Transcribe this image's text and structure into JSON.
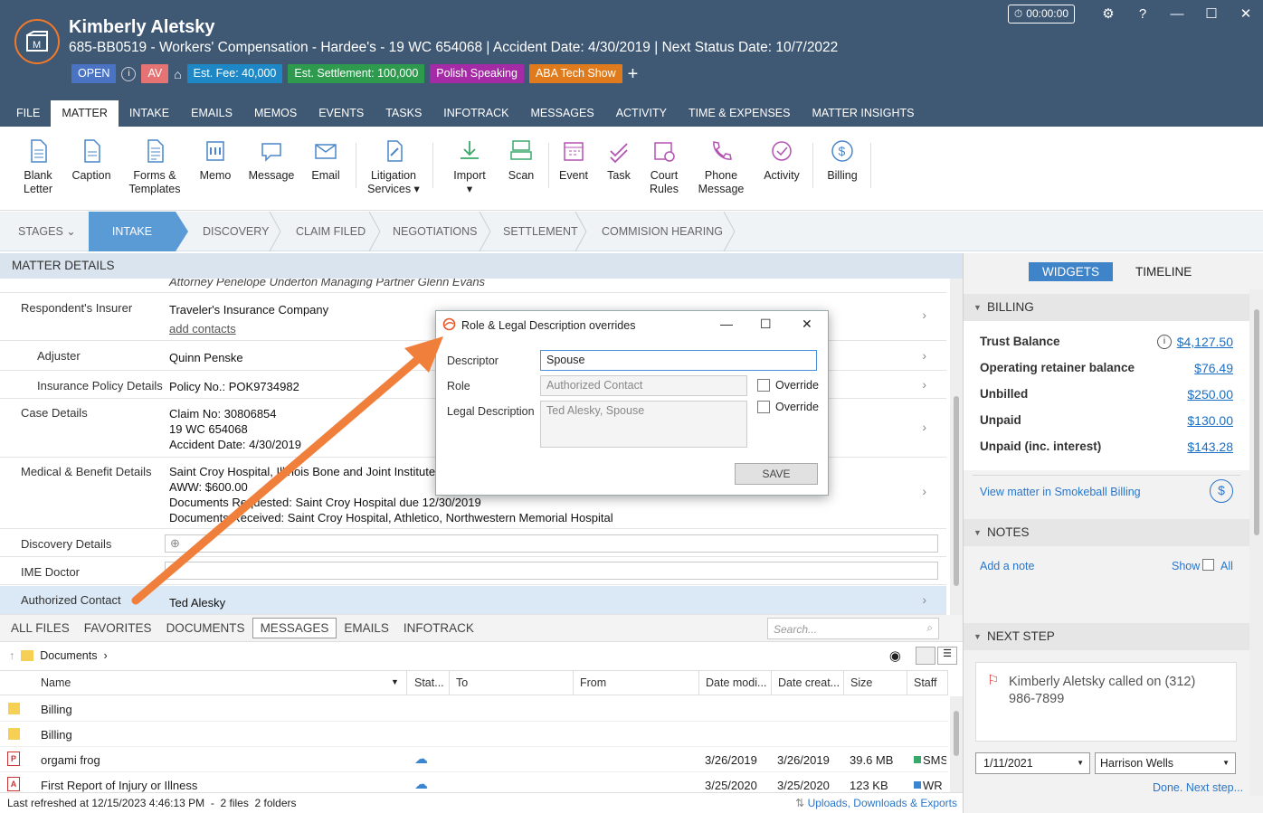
{
  "header": {
    "matter_name": "Kimberly Aletsky",
    "matter_subtitle": "685-BB0519 - Workers' Compensation - Hardee's - 19 WC 654068 | Accident Date: 4/30/2019 | Next Status Date: 10/7/2022",
    "timer": "00:00:00",
    "tags": [
      {
        "label": "OPEN",
        "color": "#4a73c4"
      },
      {
        "label": "AV",
        "color": "#e57373"
      },
      {
        "label": "Est. Fee: 40,000",
        "color": "#1e88c7"
      },
      {
        "label": "Est. Settlement: 100,000",
        "color": "#2e9a4e"
      },
      {
        "label": "Polish Speaking",
        "color": "#a52aa5"
      },
      {
        "label": "ABA Tech Show",
        "color": "#e07b1d"
      }
    ]
  },
  "tabs": [
    "FILE",
    "MATTER",
    "INTAKE",
    "EMAILS",
    "MEMOS",
    "EVENTS",
    "TASKS",
    "INFOTRACK",
    "MESSAGES",
    "ACTIVITY",
    "TIME & EXPENSES",
    "MATTER INSIGHTS"
  ],
  "ribbon": {
    "blank_letter": "Blank\nLetter",
    "caption": "Caption",
    "forms": "Forms &\nTemplates",
    "memo": "Memo",
    "message": "Message",
    "email": "Email",
    "litigation": "Litigation\nServices ▾",
    "import": "Import\n▾",
    "scan": "Scan",
    "event": "Event",
    "task": "Task",
    "court_rules": "Court\nRules",
    "phone_message": "Phone\nMessage",
    "activity": "Activity",
    "billing": "Billing"
  },
  "stages": {
    "label": "STAGES",
    "items": [
      "INTAKE",
      "DISCOVERY",
      "CLAIM FILED",
      "NEGOTIATIONS",
      "SETTLEMENT",
      "COMMISION HEARING"
    ]
  },
  "details": {
    "title": "MATTER DETAILS",
    "top_line": "Attorney Penelope Underton  Managing Partner Glenn Evans",
    "respondent_insurer": {
      "label": "Respondent's Insurer",
      "value": "Traveler's Insurance Company",
      "link": "add contacts"
    },
    "adjuster": {
      "label": "Adjuster",
      "value": "Quinn Penske"
    },
    "policy": {
      "label": "Insurance Policy Details",
      "value": "Policy No.: POK9734982"
    },
    "case": {
      "label": "Case Details",
      "lines": [
        "Claim No: 30806854",
        "19 WC 654068",
        "Accident Date: 4/30/2019"
      ]
    },
    "medical": {
      "label": "Medical & Benefit Details",
      "lines": [
        "Saint Croy Hospital, Illinois Bone and Joint Institute,",
        "AWW: $600.00",
        "Documents Requested: Saint Croy Hospital due 12/30/2019",
        "Documents Received: Saint Croy Hospital, Athletico, Northwestern Memorial Hospital"
      ]
    },
    "discovery": {
      "label": "Discovery Details"
    },
    "ime": {
      "label": "IME Doctor"
    },
    "authorized": {
      "label": "Authorized Contact",
      "value": "Ted Alesky"
    }
  },
  "files": {
    "tabs": [
      "ALL FILES",
      "FAVORITES",
      "DOCUMENTS",
      "MESSAGES",
      "EMAILS",
      "INFOTRACK"
    ],
    "search_placeholder": "Search...",
    "crumb": "Documents",
    "columns": [
      "Name",
      "Stat...",
      "To",
      "From",
      "Date modi...",
      "Date creat...",
      "Size",
      "Staff"
    ],
    "rows": [
      {
        "name": "Billing",
        "modified": "",
        "created": "",
        "size": "",
        "staff": ""
      },
      {
        "name": "Billing",
        "modified": "",
        "created": "",
        "size": "",
        "staff": ""
      },
      {
        "name": "orgami frog",
        "modified": "3/26/2019",
        "created": "3/26/2019",
        "size": "39.6 MB",
        "staff": "SMS"
      },
      {
        "name": "First Report of Injury or Illness",
        "modified": "3/25/2020",
        "created": "3/25/2020",
        "size": "123 KB",
        "staff": "WR"
      }
    ],
    "status": "Last refreshed at 12/15/2023 4:46:13 PM  -  2 files  2 folders",
    "uploads": "Uploads, Downloads & Exports"
  },
  "right": {
    "widgets": "WIDGETS",
    "timeline": "TIMELINE",
    "billing_title": "BILLING",
    "billing": [
      {
        "label": "Trust Balance",
        "amount": "$4,127.50"
      },
      {
        "label": "Operating retainer balance",
        "amount": "$76.49"
      },
      {
        "label": "Unbilled",
        "amount": "$250.00"
      },
      {
        "label": "Unpaid",
        "amount": "$130.00"
      },
      {
        "label": "Unpaid (inc. interest)",
        "amount": "$143.28"
      }
    ],
    "view_billing": "View matter in Smokeball Billing",
    "notes_title": "NOTES",
    "add_note": "Add a note",
    "show": "Show",
    "all": "All",
    "next_step_title": "NEXT STEP",
    "next_step_text": "Kimberly Aletsky called on (312) 986-7899",
    "date": "1/11/2021",
    "staff": "Harrison Wells",
    "done": "Done. Next step..."
  },
  "dialog": {
    "title": "Role & Legal Description overrides",
    "descriptor_label": "Descriptor",
    "descriptor_value": "Spouse",
    "role_label": "Role",
    "role_value": "Authorized Contact",
    "legal_label": "Legal Description",
    "legal_value": "Ted Alesky, Spouse",
    "override": "Override",
    "save": "SAVE"
  }
}
